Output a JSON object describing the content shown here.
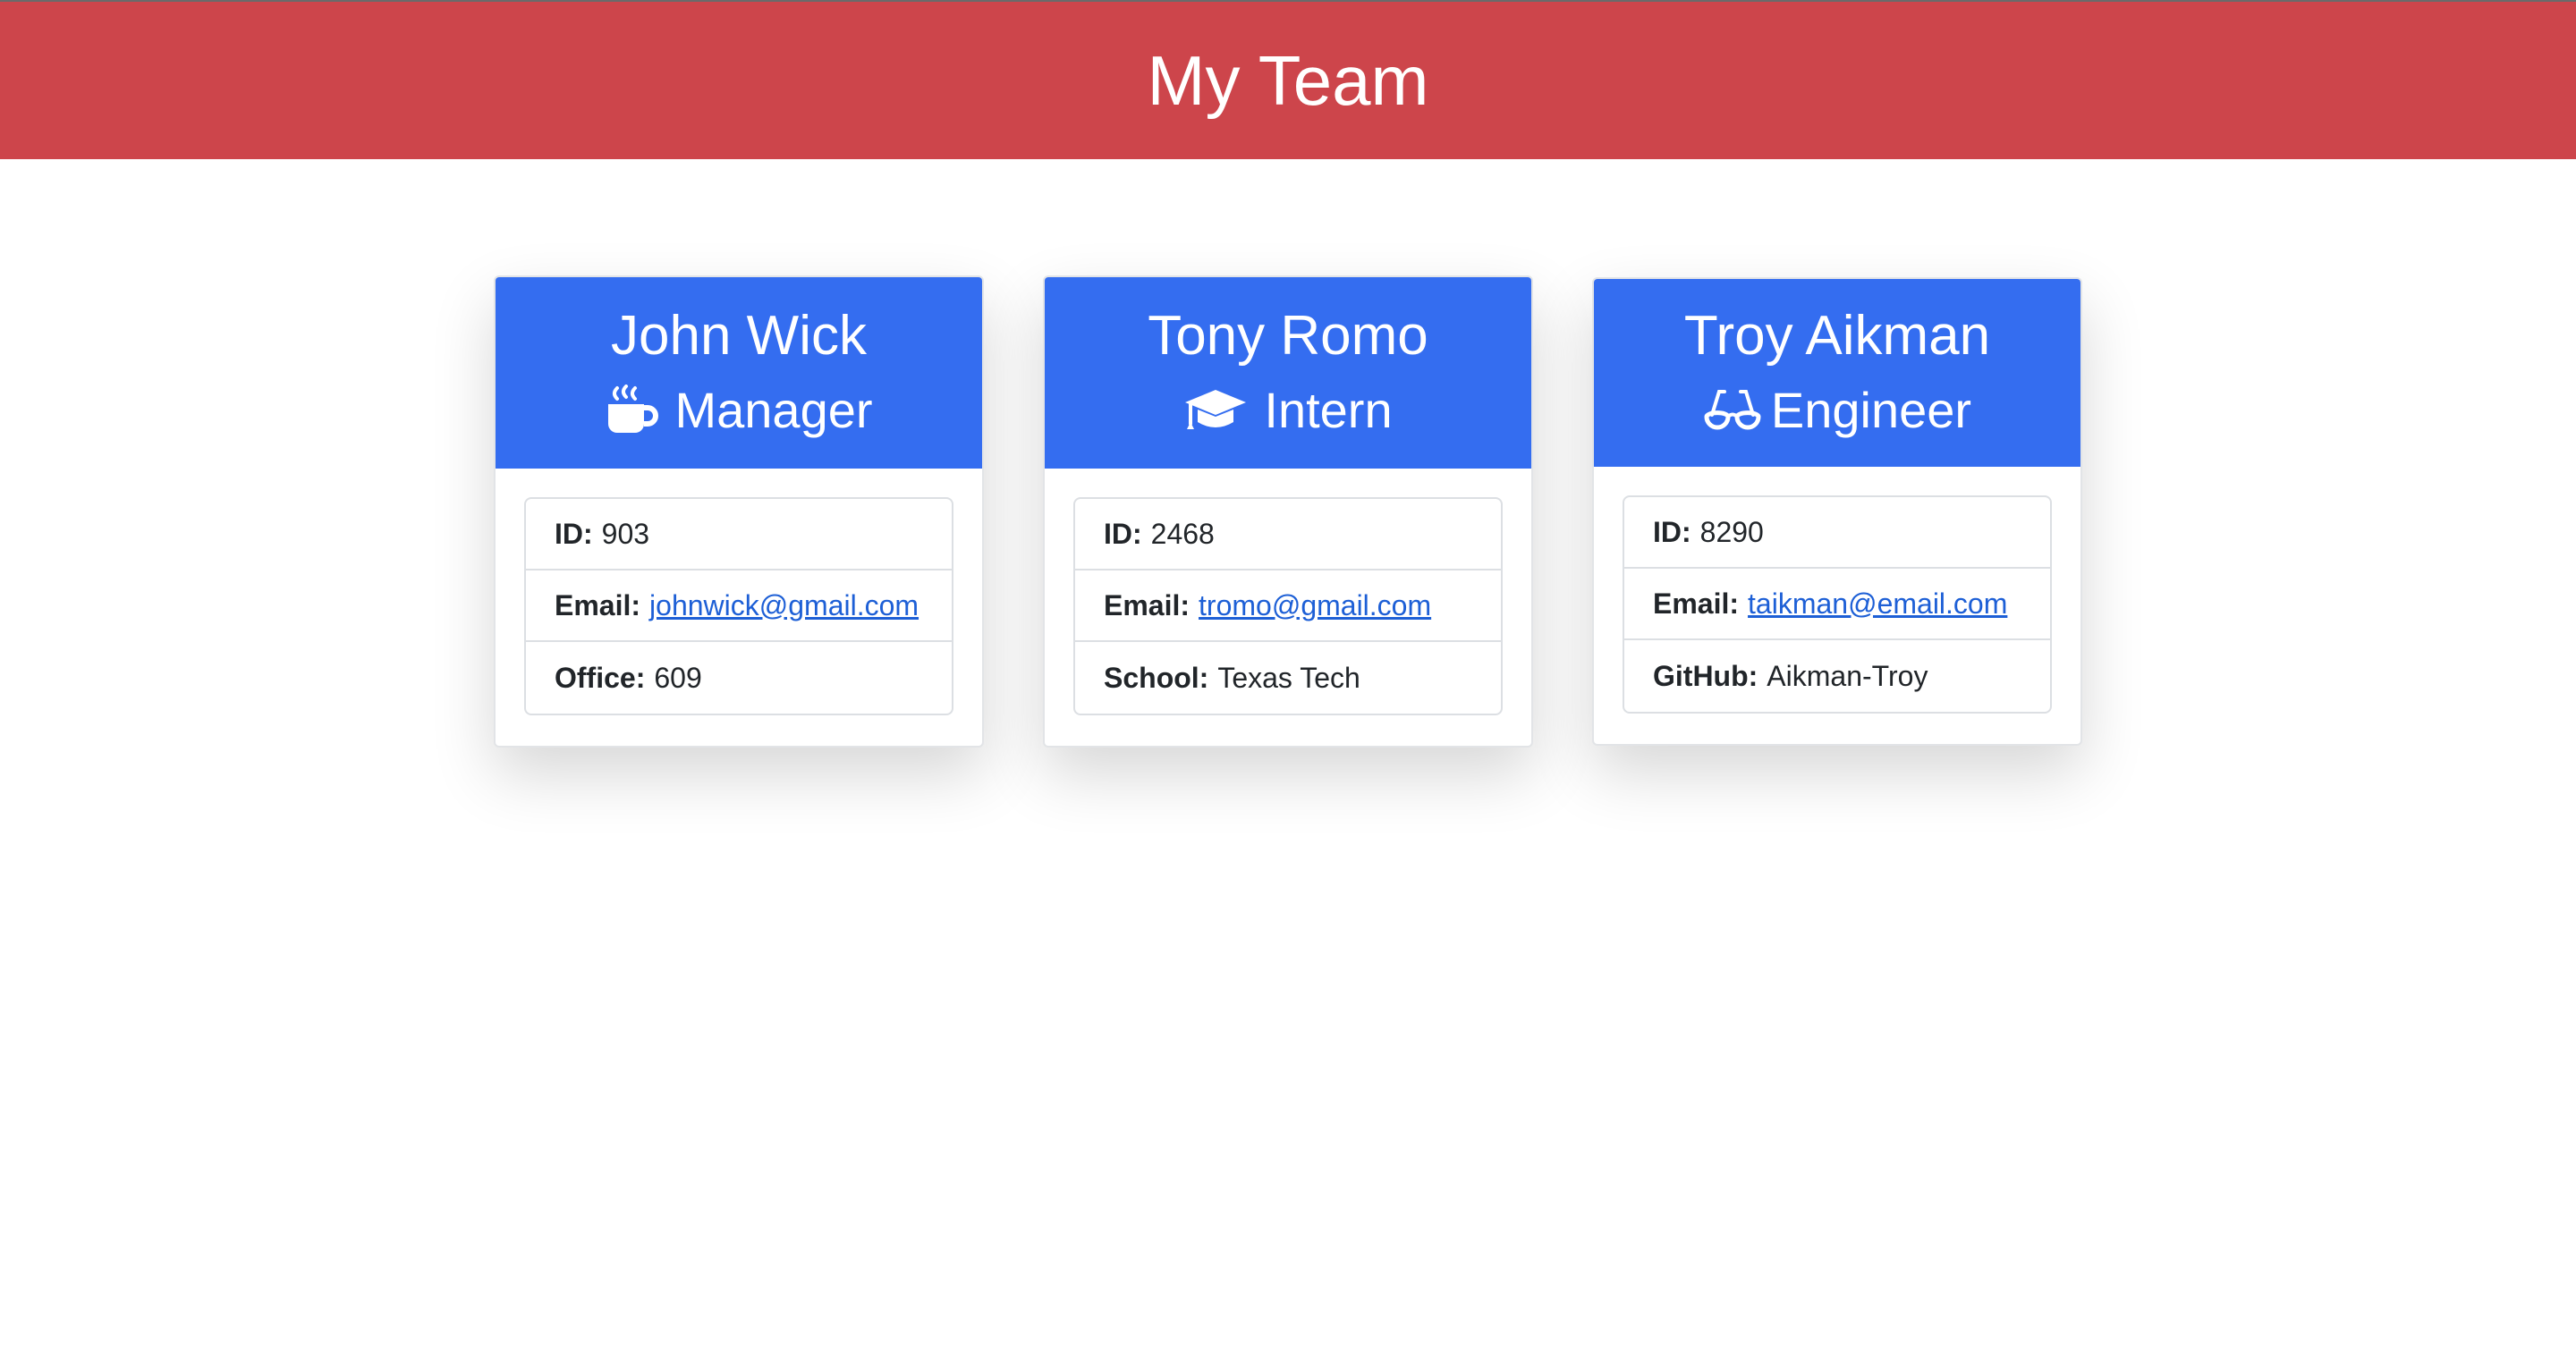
{
  "header": {
    "title": "My Team"
  },
  "colors": {
    "header_bg": "#cd454b",
    "card_head_bg": "#346df0",
    "link": "#1d5fd6"
  },
  "team": [
    {
      "name": "John Wick",
      "role": "Manager",
      "role_icon": "mug-hot-icon",
      "id_label": "ID:",
      "id": "903",
      "email_label": "Email:",
      "email": "johnwick@gmail.com",
      "extra_label": "Office:",
      "extra": "609"
    },
    {
      "name": "Tony Romo",
      "role": "Intern",
      "role_icon": "graduation-cap-icon",
      "id_label": "ID:",
      "id": "2468",
      "email_label": "Email:",
      "email": "tromo@gmail.com",
      "extra_label": "School:",
      "extra": "Texas Tech"
    },
    {
      "name": "Troy Aikman",
      "role": "Engineer",
      "role_icon": "glasses-icon",
      "id_label": "ID:",
      "id": "8290",
      "email_label": "Email:",
      "email": "taikman@email.com",
      "extra_label": "GitHub:",
      "extra": "Aikman-Troy"
    }
  ]
}
